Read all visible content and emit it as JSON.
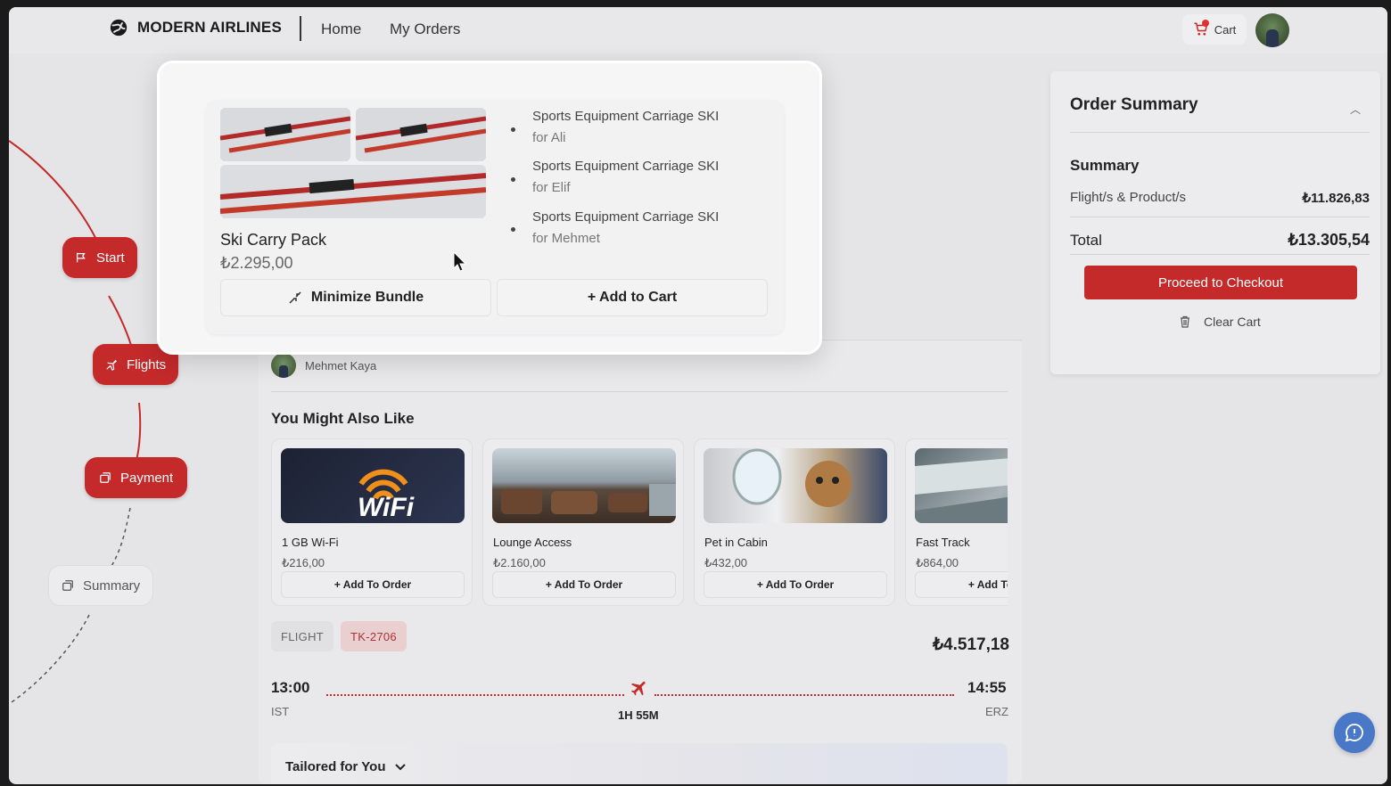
{
  "header": {
    "brand": "MODERN AIRLINES",
    "nav": [
      "Home",
      "My Orders"
    ],
    "cart_label": "Cart"
  },
  "stepper": {
    "steps": [
      {
        "label": "Start",
        "icon": "flag-icon",
        "state": "done"
      },
      {
        "label": "Flights",
        "icon": "plane-icon",
        "state": "done"
      },
      {
        "label": "Payment",
        "icon": "payment-icon",
        "state": "active"
      },
      {
        "label": "Summary",
        "icon": "summary-icon",
        "state": "pending"
      }
    ]
  },
  "bundle": {
    "name": "Ski Carry Pack",
    "price": "₺2.295,00",
    "items": [
      {
        "title": "Sports Equipment Carriage SKI",
        "for": "for Ali"
      },
      {
        "title": "Sports Equipment Carriage SKI",
        "for": "for Elif"
      },
      {
        "title": "Sports Equipment Carriage SKI",
        "for": "for Mehmet"
      }
    ],
    "minimize_label": "Minimize Bundle",
    "add_label": "+ Add to Cart"
  },
  "passenger": {
    "name": "Mehmet Kaya"
  },
  "recommendations": {
    "title": "You Might Also Like",
    "items": [
      {
        "name": "1 GB Wi-Fi",
        "price": "₺216,00",
        "add": "+ Add To Order"
      },
      {
        "name": "Lounge Access",
        "price": "₺2.160,00",
        "add": "+ Add To Order"
      },
      {
        "name": "Pet in Cabin",
        "price": "₺432,00",
        "add": "+ Add To Order"
      },
      {
        "name": "Fast Track",
        "price": "₺864,00",
        "add": "+ Add To Order"
      }
    ]
  },
  "flight": {
    "type_tag": "FLIGHT",
    "code": "TK-2706",
    "price": "₺4.517,18",
    "dep_time": "13:00",
    "dep_airport": "IST",
    "arr_time": "14:55",
    "arr_airport": "ERZ",
    "duration": "1H 55M"
  },
  "tailored": {
    "label": "Tailored for You"
  },
  "order_summary": {
    "title": "Order Summary",
    "subtitle": "Summary",
    "line_label": "Flight/s & Product/s",
    "line_value": "₺11.826,83",
    "total_label": "Total",
    "total_value": "₺13.305,54",
    "checkout_label": "Proceed to Checkout",
    "clear_label": "Clear Cart"
  },
  "colors": {
    "accent": "#c42a2a",
    "background": "#e5e5e7",
    "chat_fab": "#4a78c8"
  }
}
